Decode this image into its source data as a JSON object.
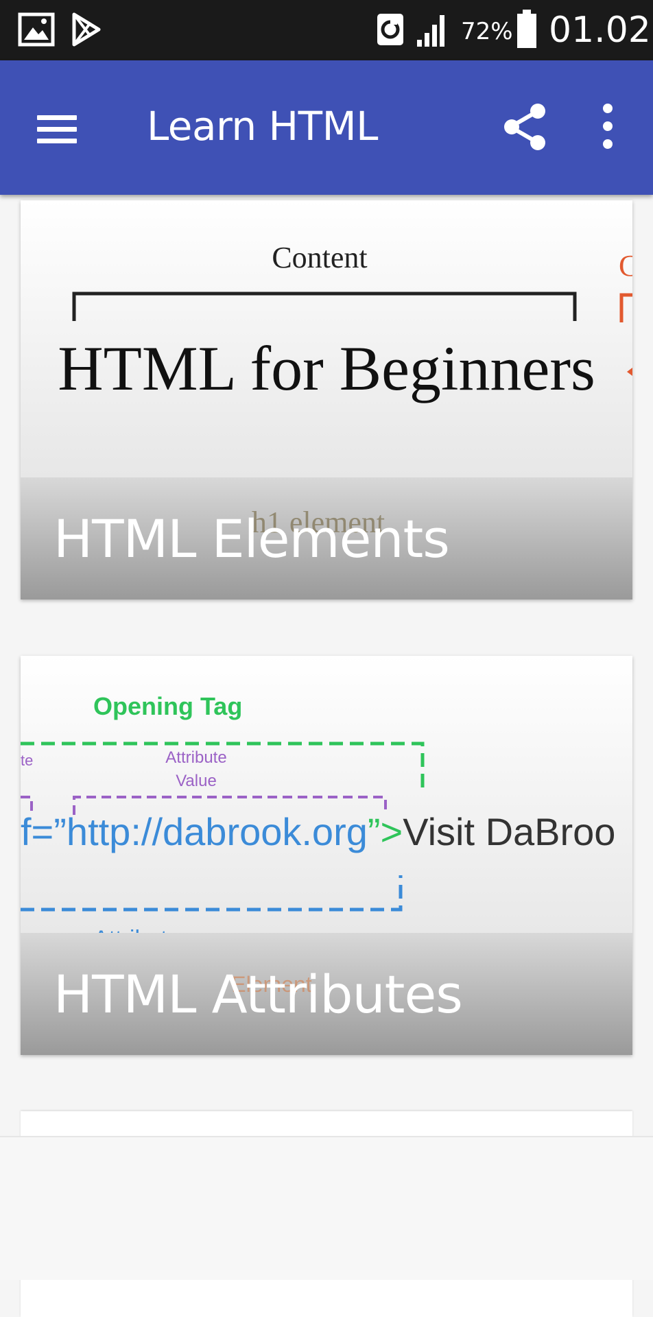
{
  "status_bar": {
    "battery_percent": "72%",
    "time": "01.02",
    "icons": [
      "gallery-icon",
      "play-store-icon",
      "sync-icon",
      "signal-icon",
      "battery-icon"
    ]
  },
  "app_bar": {
    "title": "Learn HTML",
    "icons": [
      "menu-icon",
      "share-icon",
      "more-vert-icon"
    ],
    "color": "#3f51b5"
  },
  "cards": [
    {
      "label": "HTML Elements",
      "image_text": {
        "content": "Content",
        "headline": "HTML for Beginners",
        "element": "h1 element"
      }
    },
    {
      "label": "HTML Attributes",
      "image_text": {
        "opening_tag": "Opening Tag",
        "attribute_name_fragment": "te",
        "attribute_value_label": "Attribute",
        "attribute_value_label2": "Value",
        "code_attr": "f=”",
        "code_url": "http://dabrook.org",
        "code_close": "”>",
        "code_text": "Visit DaBroo",
        "attribute_label": "Attribute",
        "element_label": "Element"
      }
    }
  ]
}
